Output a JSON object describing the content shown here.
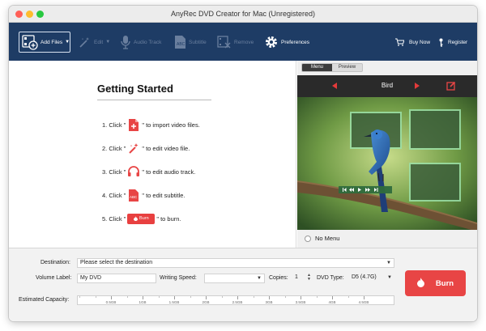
{
  "window": {
    "title": "AnyRec DVD Creator for Mac (Unregistered)"
  },
  "toolbar": {
    "add_files": "Add Files",
    "edit": "Edit",
    "audio_track": "Audio Track",
    "subtitle": "Subtitle",
    "remove": "Remove",
    "preferences": "Preferences",
    "buy_now": "Buy Now",
    "register": "Register"
  },
  "getting_started": {
    "title": "Getting Started",
    "steps": [
      {
        "prefix": "1. Click \"",
        "suffix": "\" to import video files.",
        "icon": "add-file-icon"
      },
      {
        "prefix": "2. Click \"",
        "suffix": "\" to edit video file.",
        "icon": "magic-wand-icon"
      },
      {
        "prefix": "3. Click \"",
        "suffix": "\" to edit audio track.",
        "icon": "headphones-icon"
      },
      {
        "prefix": "4. Click \"",
        "suffix": "\" to edit subtitle.",
        "icon": "subtitle-icon"
      },
      {
        "prefix": "5. Click \"",
        "suffix": "\" to burn.",
        "icon": "burn-icon",
        "button_label": "Burn"
      }
    ]
  },
  "preview": {
    "tabs": [
      "Menu",
      "Preview"
    ],
    "active_tab": "Menu",
    "menu_name": "Bird",
    "no_menu_label": "No Menu"
  },
  "settings": {
    "destination_label": "Destination:",
    "destination_value": "Please select the destination",
    "volume_label": "Volume Label:",
    "volume_value": "My DVD",
    "writing_speed_label": "Writing Speed:",
    "writing_speed_value": "",
    "copies_label": "Copies:",
    "copies_value": "1",
    "dvd_type_label": "DVD Type:",
    "dvd_type_value": "D5 (4.7G)",
    "capacity_label": "Estimated Capacity:",
    "capacity_ticks": [
      "0.5GB",
      "1GB",
      "1.5GB",
      "2GB",
      "2.5GB",
      "3GB",
      "3.5GB",
      "4GB",
      "4.5GB"
    ]
  },
  "burn": {
    "label": "Burn"
  },
  "colors": {
    "toolbar_bg": "#1e3c65",
    "accent_red": "#e84545",
    "menu_bar_bg": "#2a2a2a"
  }
}
